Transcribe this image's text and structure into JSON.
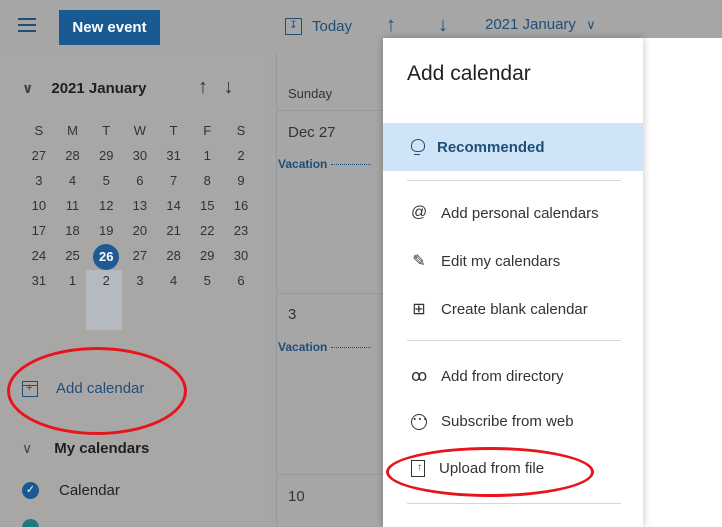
{
  "toolbar": {
    "new_event_label": "New event",
    "today_label": "Today",
    "month_label": "2021 January",
    "today_icon_glyph": "↧",
    "up_glyph": "↑",
    "down_glyph": "↓",
    "dropdown_glyph": "∨"
  },
  "mini_calendar": {
    "month_label": "2021 January",
    "chevron_glyph": "∨",
    "up_glyph": "↑",
    "down_glyph": "↓",
    "weekdays": [
      "S",
      "M",
      "T",
      "W",
      "T",
      "F",
      "S"
    ],
    "weeks": [
      [
        "27",
        "28",
        "29",
        "30",
        "31",
        "1",
        "2"
      ],
      [
        "3",
        "4",
        "5",
        "6",
        "7",
        "8",
        "9"
      ],
      [
        "10",
        "11",
        "12",
        "13",
        "14",
        "15",
        "16"
      ],
      [
        "17",
        "18",
        "19",
        "20",
        "21",
        "22",
        "23"
      ],
      [
        "24",
        "25",
        "26",
        "27",
        "28",
        "29",
        "30"
      ],
      [
        "31",
        "1",
        "2",
        "3",
        "4",
        "5",
        "6"
      ]
    ],
    "today": "26"
  },
  "sidebar": {
    "add_calendar_label": "Add calendar",
    "my_calendars_label": "My calendars",
    "my_calendars_chevron": "∨",
    "calendar_item_label": "Calendar",
    "check_glyph": "✓"
  },
  "calendar_view": {
    "day_header": "Sunday",
    "dates": [
      "Dec 27",
      "3",
      "10"
    ],
    "event_label": "Vacation"
  },
  "panel": {
    "title": "Add calendar",
    "recommended_label": "Recommended",
    "items": [
      {
        "label": "Add personal calendars",
        "icon": "@"
      },
      {
        "label": "Edit my calendars",
        "icon": "✎"
      },
      {
        "label": "Create blank calendar",
        "icon": "⊞"
      },
      {
        "label": "Add from directory",
        "icon": "ꝏ"
      },
      {
        "label": "Subscribe from web",
        "icon": "⋯"
      },
      {
        "label": "Upload from file",
        "icon": ""
      }
    ]
  },
  "colors": {
    "accent": "#1a5a93",
    "highlight": "#cfe4f7",
    "annotation": "#e8141c"
  }
}
